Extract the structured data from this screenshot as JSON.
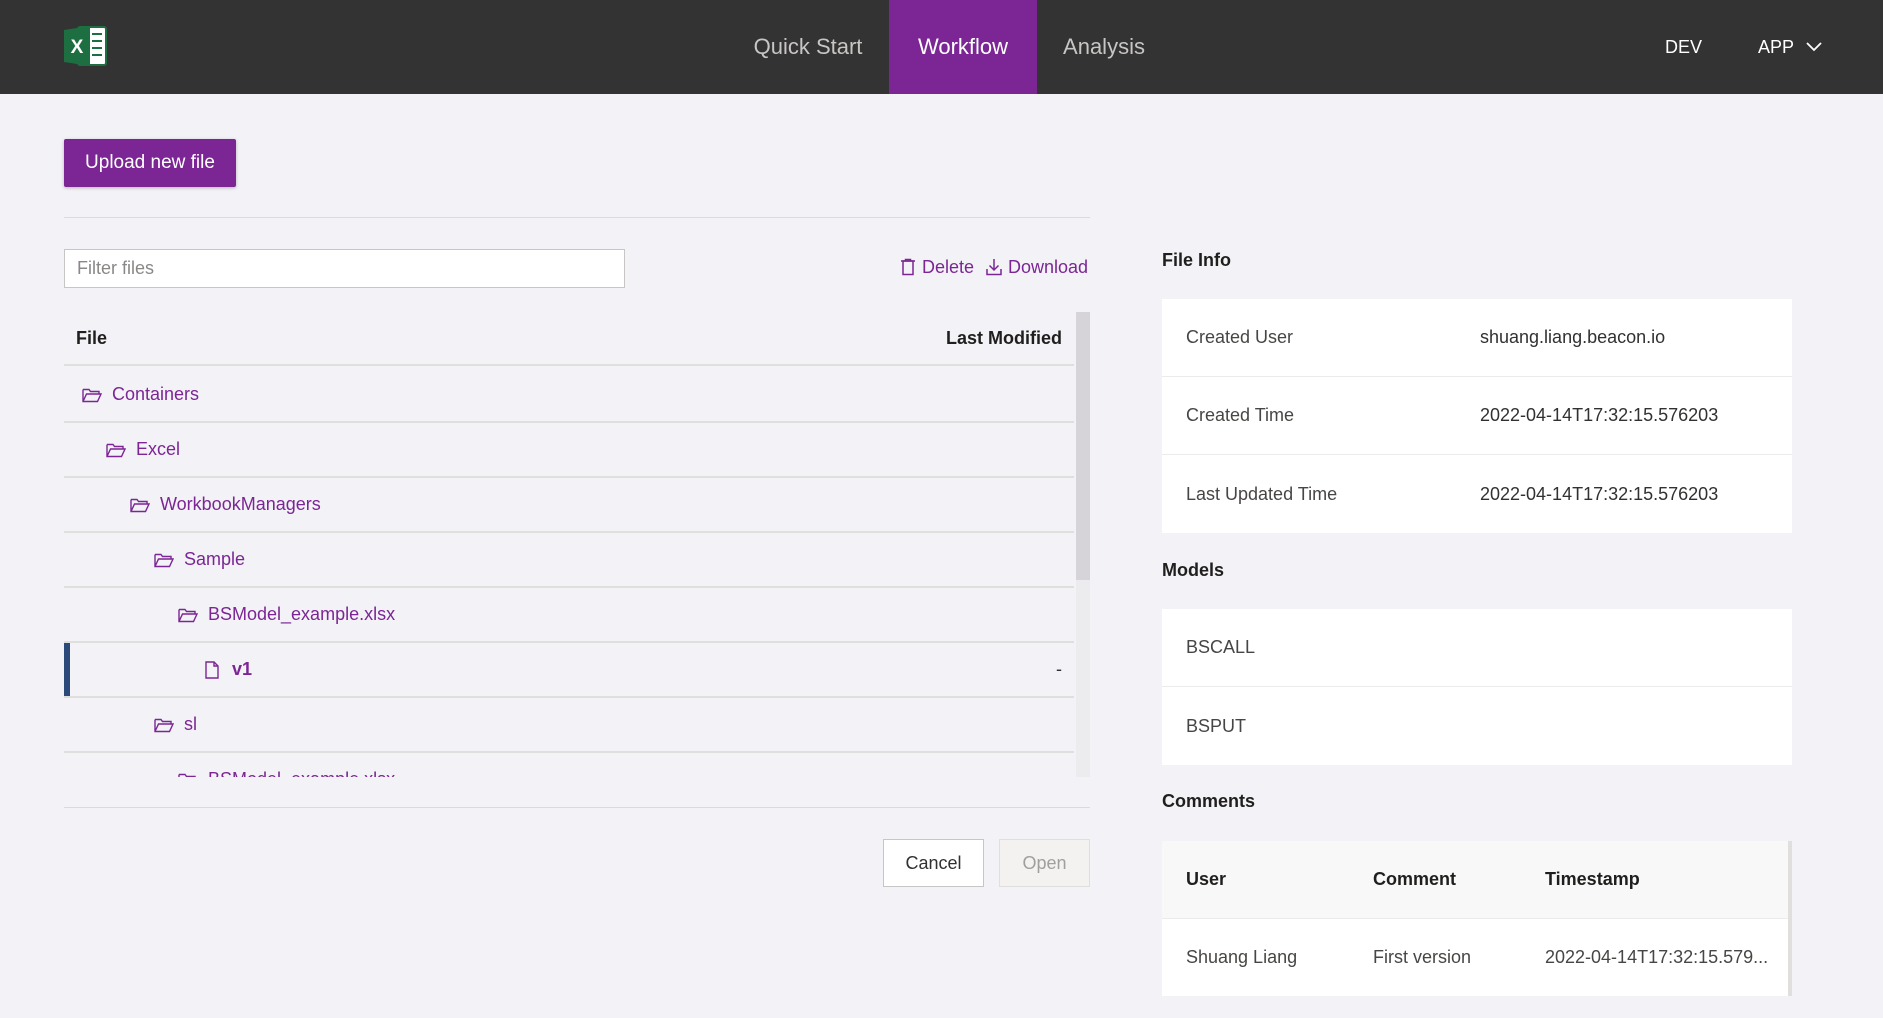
{
  "header": {
    "tabs": [
      {
        "label": "Quick Start",
        "active": false
      },
      {
        "label": "Workflow",
        "active": true
      },
      {
        "label": "Analysis",
        "active": false
      }
    ],
    "env_label": "DEV",
    "app_label": "APP",
    "accent_color": "#7b2694",
    "bar_color": "#333333"
  },
  "workflow": {
    "upload_label": "Upload new file",
    "filter_placeholder": "Filter files",
    "filter_value": "",
    "delete_label": "Delete",
    "download_label": "Download",
    "columns": {
      "file": "File",
      "last_modified": "Last Modified"
    },
    "tree": [
      {
        "name": "Containers",
        "type": "folder",
        "depth": 0,
        "modified": ""
      },
      {
        "name": "Excel",
        "type": "folder",
        "depth": 1,
        "modified": ""
      },
      {
        "name": "WorkbookManagers",
        "type": "folder",
        "depth": 2,
        "modified": ""
      },
      {
        "name": "Sample",
        "type": "folder",
        "depth": 3,
        "modified": ""
      },
      {
        "name": "BSModel_example.xlsx",
        "type": "folder",
        "depth": 4,
        "modified": ""
      },
      {
        "name": "v1",
        "type": "file",
        "depth": 5,
        "modified": "-",
        "selected": true
      },
      {
        "name": "sl",
        "type": "folder",
        "depth": 3,
        "modified": ""
      },
      {
        "name": "BSModel_example.xlsx",
        "type": "folder",
        "depth": 4,
        "modified": ""
      }
    ],
    "cancel_label": "Cancel",
    "open_label": "Open"
  },
  "file_info": {
    "title": "File Info",
    "rows": [
      {
        "label": "Created User",
        "value": "shuang.liang.beacon.io"
      },
      {
        "label": "Created Time",
        "value": "2022-04-14T17:32:15.576203"
      },
      {
        "label": "Last Updated Time",
        "value": "2022-04-14T17:32:15.576203"
      }
    ]
  },
  "models": {
    "title": "Models",
    "items": [
      "BSCALL",
      "BSPUT"
    ]
  },
  "comments": {
    "title": "Comments",
    "columns": {
      "user": "User",
      "comment": "Comment",
      "timestamp": "Timestamp"
    },
    "rows": [
      {
        "user": "Shuang Liang",
        "comment": "First version",
        "timestamp": "2022-04-14T17:32:15.579..."
      }
    ]
  }
}
